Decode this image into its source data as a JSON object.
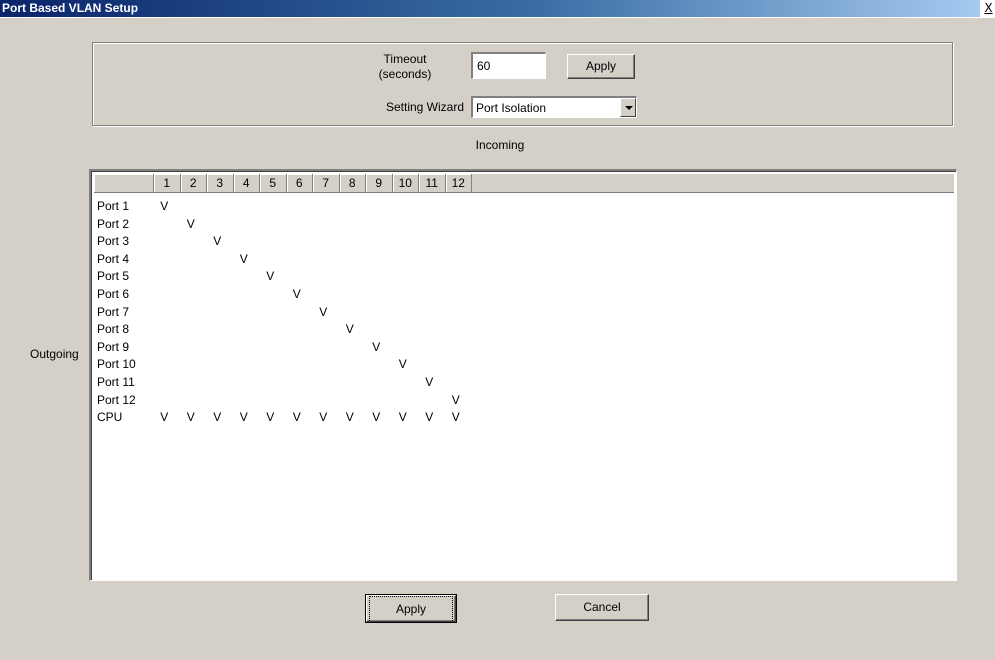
{
  "window": {
    "title": "Port Based VLAN Setup",
    "close_glyph": "X"
  },
  "settings": {
    "timeout_label": "Timeout\n(seconds)",
    "timeout_value": "60",
    "apply_label": "Apply",
    "wizard_label": "Setting Wizard",
    "wizard_value": "Port Isolation"
  },
  "matrix": {
    "incoming_label": "Incoming",
    "outgoing_label": "Outgoing",
    "columns": [
      "1",
      "2",
      "3",
      "4",
      "5",
      "6",
      "7",
      "8",
      "9",
      "10",
      "11",
      "12"
    ],
    "rows": [
      {
        "label": "Port 1",
        "checked": [
          1
        ]
      },
      {
        "label": "Port 2",
        "checked": [
          2
        ]
      },
      {
        "label": "Port 3",
        "checked": [
          3
        ]
      },
      {
        "label": "Port 4",
        "checked": [
          4
        ]
      },
      {
        "label": "Port 5",
        "checked": [
          5
        ]
      },
      {
        "label": "Port 6",
        "checked": [
          6
        ]
      },
      {
        "label": "Port 7",
        "checked": [
          7
        ]
      },
      {
        "label": "Port 8",
        "checked": [
          8
        ]
      },
      {
        "label": "Port 9",
        "checked": [
          9
        ]
      },
      {
        "label": "Port 10",
        "checked": [
          10
        ]
      },
      {
        "label": "Port 11",
        "checked": [
          11
        ]
      },
      {
        "label": "Port 12",
        "checked": [
          12
        ]
      },
      {
        "label": "CPU",
        "checked": [
          1,
          2,
          3,
          4,
          5,
          6,
          7,
          8,
          9,
          10,
          11,
          12
        ]
      }
    ],
    "mark": "V"
  },
  "footer": {
    "apply_label": "Apply",
    "cancel_label": "Cancel"
  }
}
